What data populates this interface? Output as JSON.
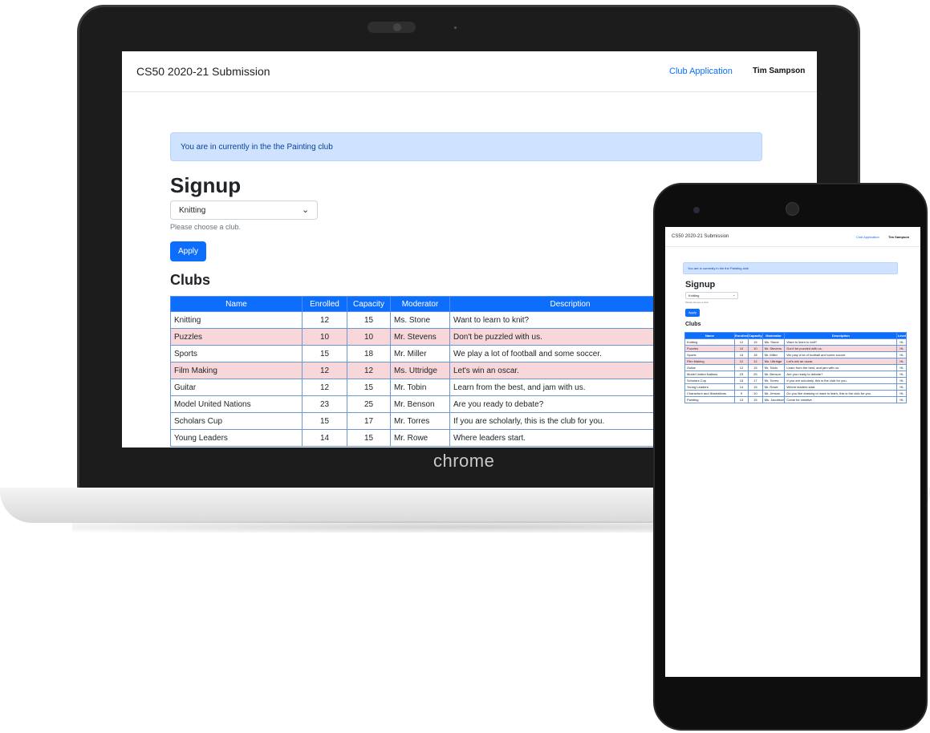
{
  "laptop": {
    "brand_logo": "chrome",
    "nav": {
      "brand": "CS50 2020-21 Submission",
      "link": "Club Application",
      "user": "Tim Sampson"
    },
    "alert": "You are in currently in the the Painting club",
    "heading": "Signup",
    "select_value": "Knitting",
    "select_icon": "chevron-down-icon",
    "help_text": "Please choose a club.",
    "apply_label": "Apply",
    "clubs_heading": "Clubs",
    "table": {
      "headers": [
        "Name",
        "Enrolled",
        "Capacity",
        "Moderator",
        "Description"
      ],
      "rows": [
        {
          "name": "Knitting",
          "enrolled": "12",
          "capacity": "15",
          "moderator": "Ms. Stone",
          "description": "Want to learn to knit?",
          "full": false
        },
        {
          "name": "Puzzles",
          "enrolled": "10",
          "capacity": "10",
          "moderator": "Mr. Stevens",
          "description": "Don't be puzzled with us.",
          "full": true
        },
        {
          "name": "Sports",
          "enrolled": "15",
          "capacity": "18",
          "moderator": "Mr. Miller",
          "description": "We play a lot of football and some soccer.",
          "full": false
        },
        {
          "name": "Film Making",
          "enrolled": "12",
          "capacity": "12",
          "moderator": "Ms. Uttridge",
          "description": "Let's win an oscar.",
          "full": true
        },
        {
          "name": "Guitar",
          "enrolled": "12",
          "capacity": "15",
          "moderator": "Mr. Tobin",
          "description": "Learn from the best, and jam with us.",
          "full": false
        },
        {
          "name": "Model United Nations",
          "enrolled": "23",
          "capacity": "25",
          "moderator": "Mr. Benson",
          "description": "Are you ready to debate?",
          "full": false
        },
        {
          "name": "Scholars Cup",
          "enrolled": "15",
          "capacity": "17",
          "moderator": "Mr. Torres",
          "description": "If you are scholarly, this is the club for you.",
          "full": false
        },
        {
          "name": "Young Leaders",
          "enrolled": "14",
          "capacity": "15",
          "moderator": "Mr. Rowe",
          "description": "Where leaders start.",
          "full": false
        }
      ]
    }
  },
  "phone": {
    "nav": {
      "brand": "CS50 2020-21 Submission",
      "link": "Club Application",
      "user": "Tim Sampson"
    },
    "alert": "You are in currently in the the Painting club",
    "heading": "Signup",
    "select_value": "Knitting",
    "help_text": "Please choose a club.",
    "apply_label": "Apply",
    "clubs_heading": "Clubs",
    "table": {
      "headers": [
        "Name",
        "Enrolled",
        "Capacity",
        "Moderator",
        "Description",
        "Level"
      ],
      "rows": [
        {
          "name": "Knitting",
          "enrolled": "12",
          "capacity": "15",
          "moderator": "Ms. Stone",
          "description": "Want to learn to knit?",
          "level": "HL",
          "full": false
        },
        {
          "name": "Puzzles",
          "enrolled": "10",
          "capacity": "10",
          "moderator": "Mr. Stevens",
          "description": "Don't be puzzled with us.",
          "level": "HL",
          "full": true
        },
        {
          "name": "Sports",
          "enrolled": "15",
          "capacity": "18",
          "moderator": "Mr. Miller",
          "description": "We play a lot of football and some soccer.",
          "level": "HL",
          "full": false
        },
        {
          "name": "Film Making",
          "enrolled": "12",
          "capacity": "12",
          "moderator": "Ms. Uttridge",
          "description": "Let's win an oscar.",
          "level": "HL",
          "full": true
        },
        {
          "name": "Guitar",
          "enrolled": "12",
          "capacity": "15",
          "moderator": "Mr. Tobin",
          "description": "Learn from the best, and jam with us.",
          "level": "HL",
          "full": false
        },
        {
          "name": "Model United Nations",
          "enrolled": "23",
          "capacity": "25",
          "moderator": "Mr. Benson",
          "description": "Are you ready to debate?",
          "level": "HL",
          "full": false
        },
        {
          "name": "Scholars Cup",
          "enrolled": "15",
          "capacity": "17",
          "moderator": "Mr. Torres",
          "description": "If you are scholarly, this is the club for you.",
          "level": "HL",
          "full": false
        },
        {
          "name": "Young Leaders",
          "enrolled": "14",
          "capacity": "15",
          "moderator": "Mr. Rowe",
          "description": "Where leaders start.",
          "level": "HL",
          "full": false
        },
        {
          "name": "Characture and Illustrations",
          "enrolled": "9",
          "capacity": "10",
          "moderator": "Mr. Jenson",
          "description": "Do you like drawing or want to learn, this is the club for you.",
          "level": "HL",
          "full": false
        },
        {
          "name": "Painting",
          "enrolled": "13",
          "capacity": "15",
          "moderator": "Ms. Jacobson",
          "description": "Come be creative",
          "level": "HL",
          "full": false
        }
      ]
    }
  }
}
